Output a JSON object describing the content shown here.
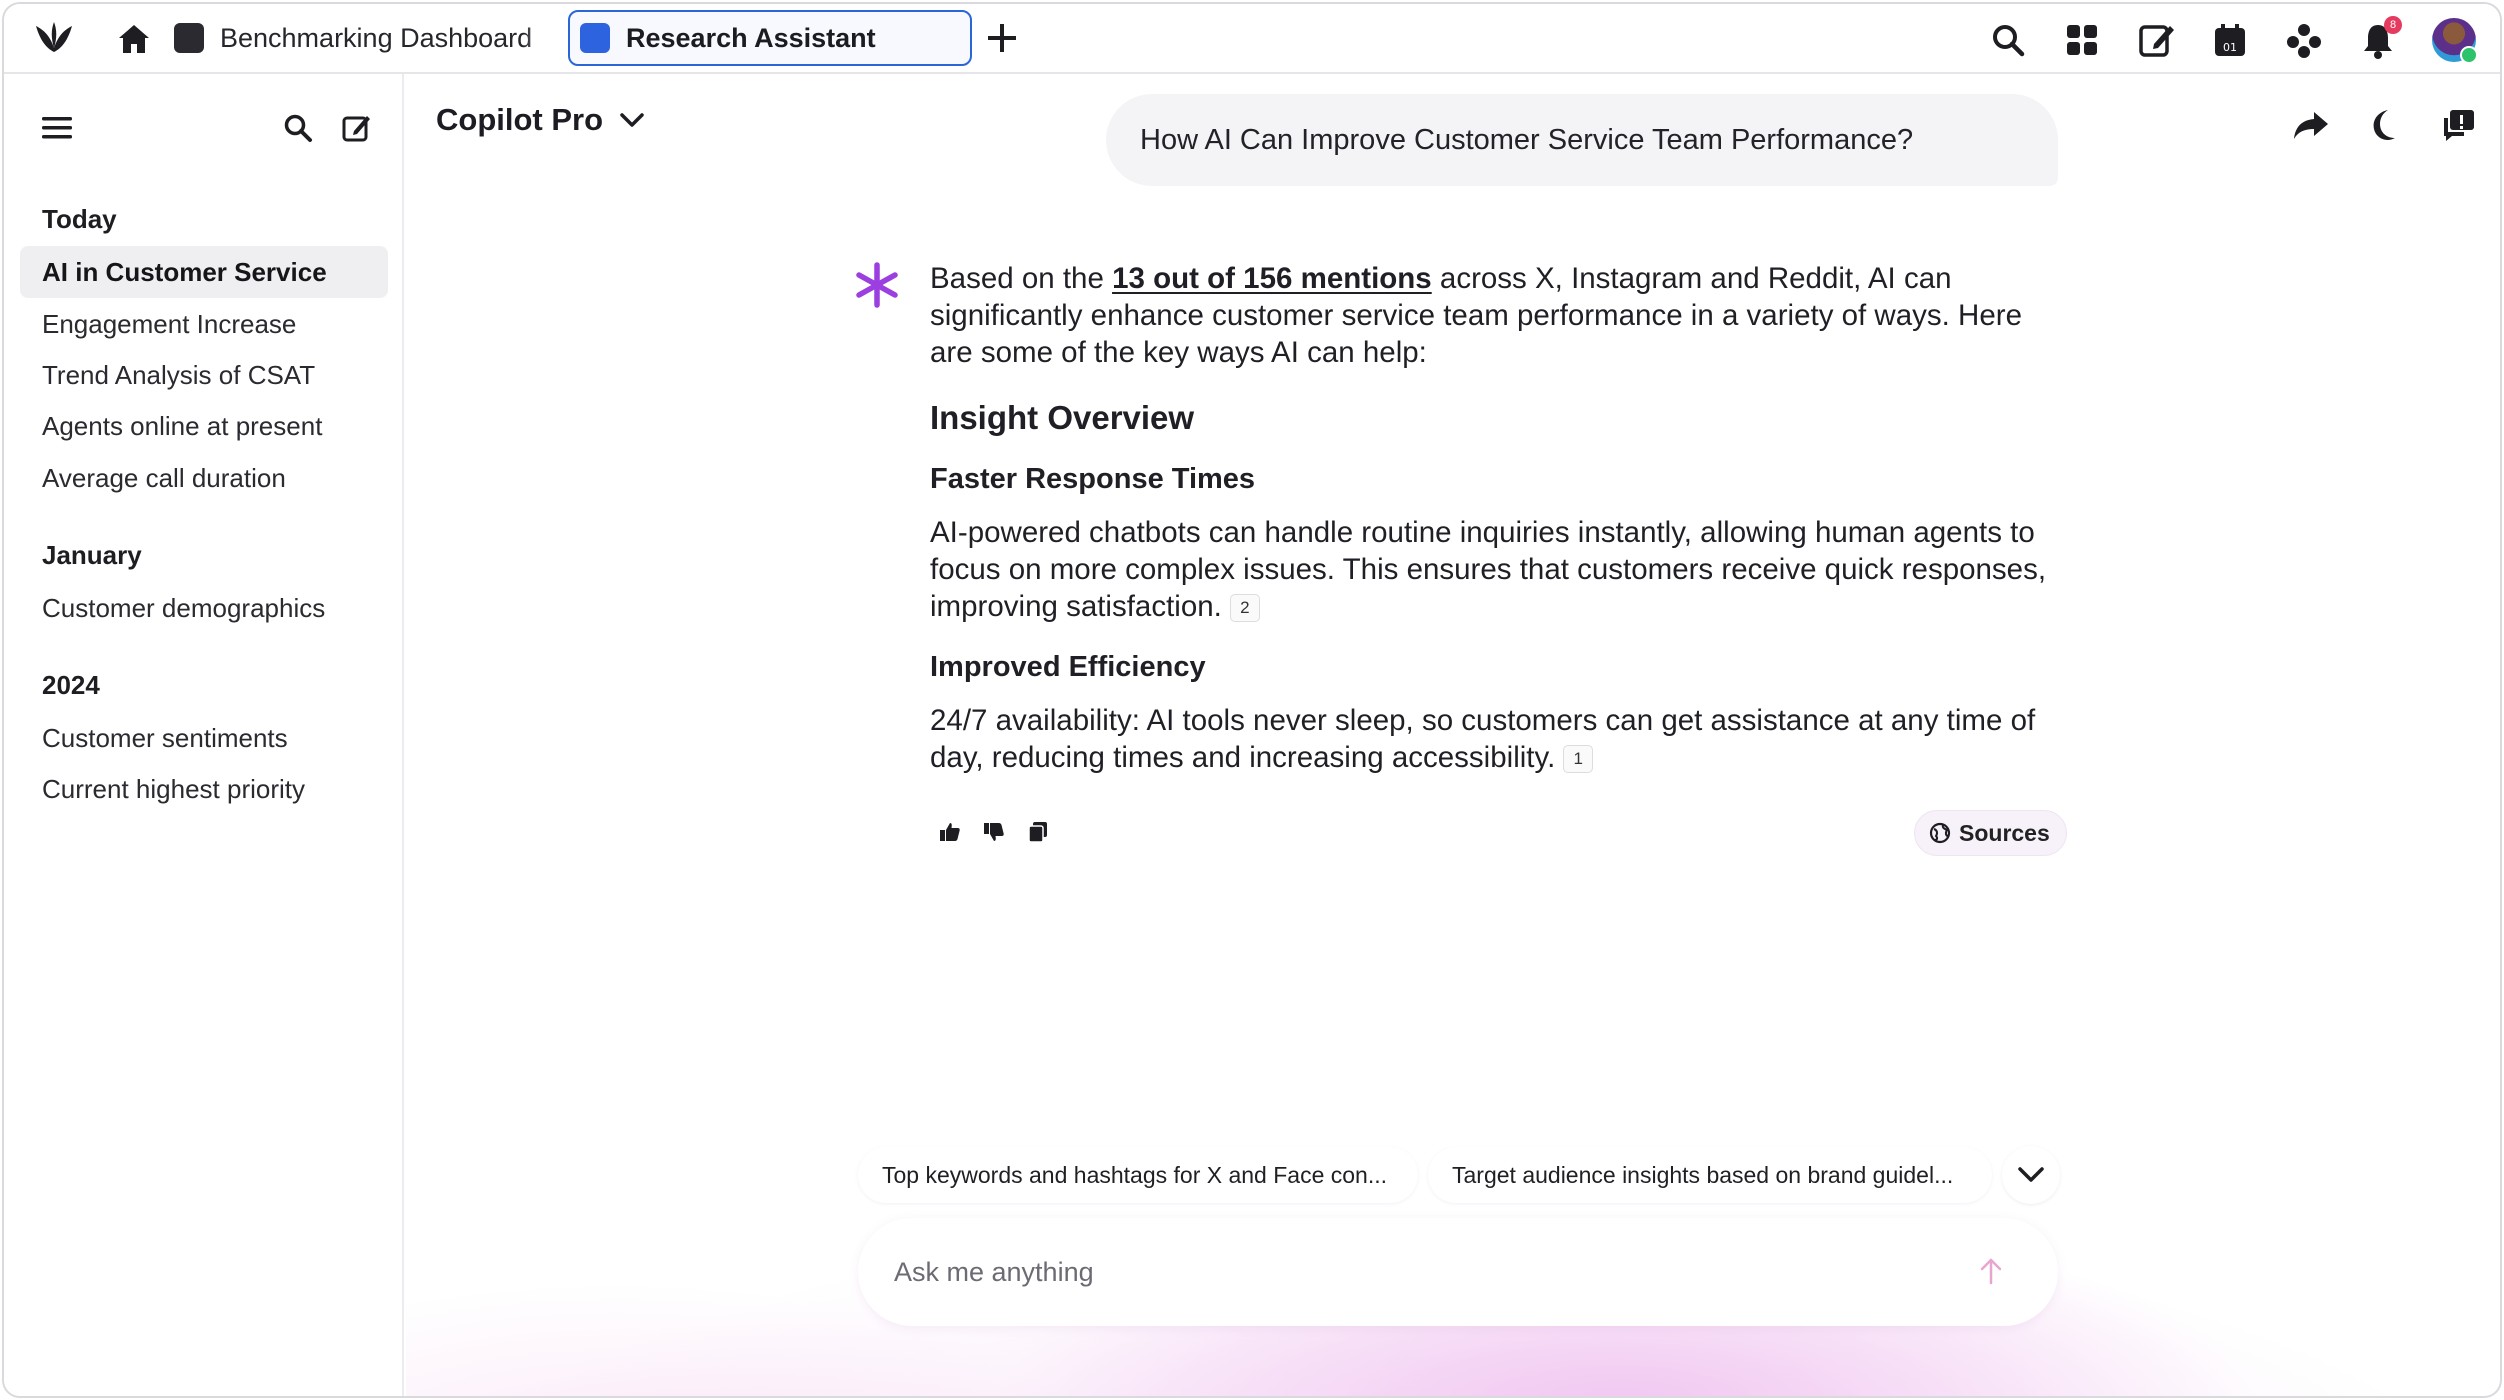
{
  "tabs": [
    {
      "label": "Benchmarking Dashboard"
    },
    {
      "label": "Research Assistant"
    }
  ],
  "notifications": {
    "count": "8"
  },
  "sidebar": {
    "groups": [
      {
        "title": "Today",
        "items": [
          "AI in Customer Service",
          "Engagement Increase",
          "Trend Analysis of CSAT",
          "Agents online at present",
          "Average call duration"
        ]
      },
      {
        "title": "January",
        "items": [
          "Customer demographics"
        ]
      },
      {
        "title": "2024",
        "items": [
          "Customer sentiments",
          "Current highest priority"
        ]
      }
    ]
  },
  "main": {
    "model": "Copilot Pro",
    "question": "How AI Can Improve Customer Service Team Performance?",
    "answer": {
      "intro_prefix": "Based on the ",
      "mentions_link": "13 out of 156 mentions",
      "intro_suffix": " across X, Instagram and Reddit, AI can significantly enhance customer service team performance in a variety of ways. Here are some of the key ways AI can help:",
      "heading": "Insight Overview",
      "sections": [
        {
          "title": "Faster Response Times",
          "body": "AI-powered chatbots can handle routine inquiries instantly, allowing human agents to focus on more complex issues. This ensures that customers receive quick responses, improving satisfaction.",
          "cite": "2"
        },
        {
          "title": "Improved Efficiency",
          "body": "24/7 availability: AI tools never sleep, so customers can get assistance at any time of day, reducing times and increasing accessibility.",
          "cite": "1"
        }
      ]
    },
    "sources_label": "Sources",
    "suggestions": [
      "Top keywords and hashtags for X and Face con...",
      "Target audience insights based on brand guidel..."
    ],
    "input_placeholder": "Ask me anything"
  },
  "colors": {
    "accent": "#2b66d9",
    "ai_star": "#9b3fe0",
    "badge": "#e53b5e"
  }
}
